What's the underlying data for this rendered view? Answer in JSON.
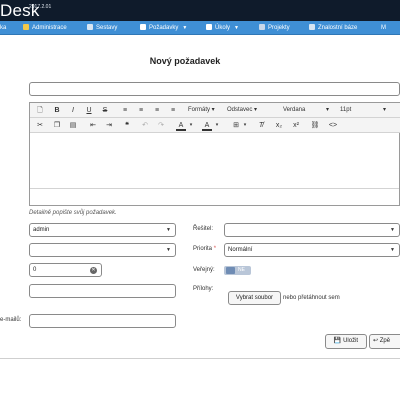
{
  "header": {
    "brand": "Desk",
    "version": "2017.2.01"
  },
  "nav": {
    "items": [
      {
        "label": "ka"
      },
      {
        "label": "Administrace"
      },
      {
        "label": "Sestavy"
      },
      {
        "label": "Požadavky"
      },
      {
        "label": "Úkoly"
      },
      {
        "label": "Projekty"
      },
      {
        "label": "Znalostní báze"
      },
      {
        "label": "M"
      }
    ]
  },
  "form": {
    "title": "Nový požadavek",
    "subject_value": "",
    "editor_hint": "Detailně popište svůj požadavek.",
    "requester_value": "admin",
    "second_select_value": "",
    "number_value": "0",
    "text_field_value": "",
    "email_label": "e-mailů:",
    "email_value": "",
    "resolver_label": "Řešitel:",
    "resolver_value": "",
    "priority_label": "Priorita",
    "priority_required": "*",
    "priority_value": "Normální",
    "public_label": "Veřejný:",
    "public_toggle_text": "NE",
    "attachments_label": "Přílohy:",
    "choose_file_label": "Vybrat soubor",
    "drop_text": "nebo přetáhnout sem"
  },
  "toolbar": {
    "formats": "Formáty",
    "paragraph": "Odstavec",
    "font": "Verdana",
    "size": "11pt"
  },
  "actions": {
    "save_label": "Uložit",
    "back_label": "Zpě"
  },
  "colors": {
    "topbar": "#0f1b2b",
    "navbar": "#3f8fd5",
    "border": "#8a8a8a"
  }
}
